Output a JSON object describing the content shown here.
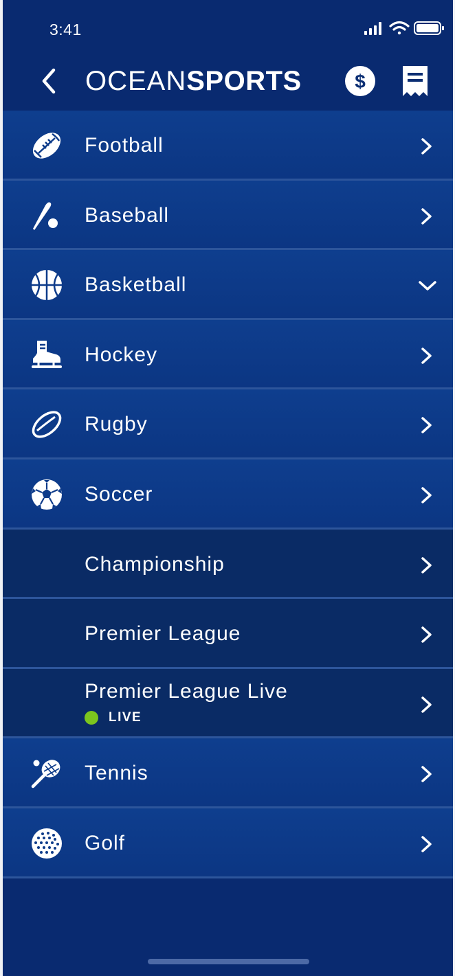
{
  "status_bar": {
    "time": "3:41"
  },
  "header": {
    "brand_light": "OCEAN",
    "brand_bold": "SPORTS",
    "icons": [
      "chevron-left-icon",
      "dollar-coin-icon",
      "receipt-icon"
    ]
  },
  "menu": {
    "items": [
      {
        "label": "Football",
        "icon": "football-icon",
        "expanded": false
      },
      {
        "label": "Baseball",
        "icon": "baseball-bat-icon",
        "expanded": false
      },
      {
        "label": "Basketball",
        "icon": "basketball-icon",
        "expanded": true
      },
      {
        "label": "Hockey",
        "icon": "hockey-skate-icon",
        "expanded": false
      },
      {
        "label": "Rugby",
        "icon": "rugby-ball-icon",
        "expanded": false
      },
      {
        "label": "Soccer",
        "icon": "soccer-ball-icon",
        "expanded": false
      },
      {
        "label": "Championship"
      },
      {
        "label": "Premier League"
      },
      {
        "label": "Premier League Live",
        "badge": "LIVE"
      },
      {
        "label": "Tennis",
        "icon": "tennis-racket-icon",
        "expanded": false
      },
      {
        "label": "Golf",
        "icon": "golf-ball-icon",
        "expanded": false
      }
    ]
  },
  "colors": {
    "background": "#092a70",
    "row_sport": "#0e3e8e",
    "row_sub": "#0a2b65",
    "divider": "#2d559b",
    "live": "#7cc61e"
  }
}
